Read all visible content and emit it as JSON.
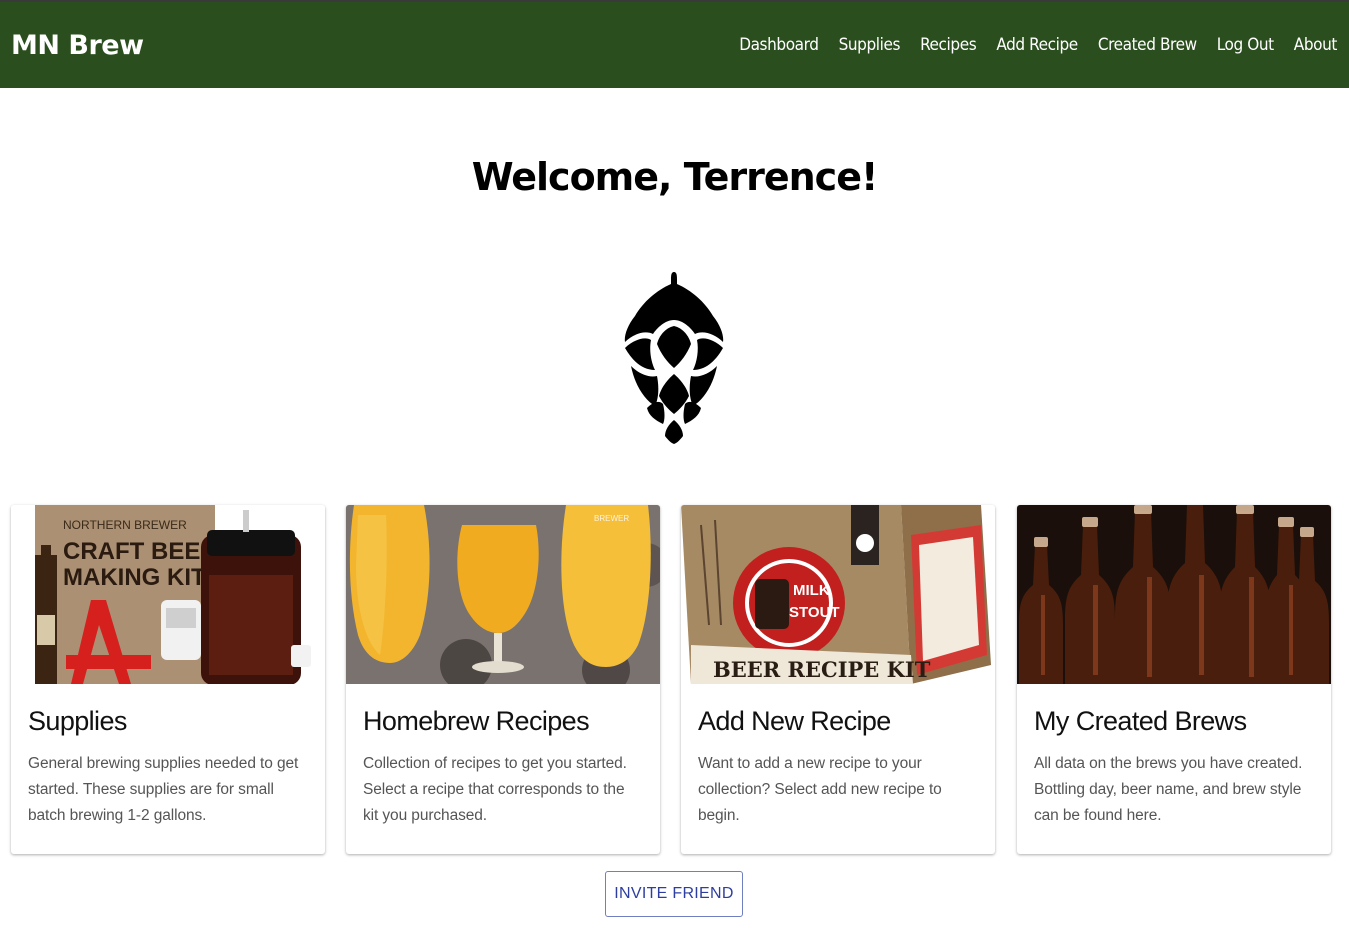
{
  "nav": {
    "brand": "MN Brew",
    "links": [
      "Dashboard",
      "Supplies",
      "Recipes",
      "Add Recipe",
      "Created Brew",
      "Log Out",
      "About"
    ]
  },
  "welcome": "Welcome, Terrence!",
  "logo_icon": "hop-icon",
  "cards": [
    {
      "title": "Supplies",
      "text": "General brewing supplies needed to get started. These supplies are for small batch brewing 1-2 gallons.",
      "image": "craft-beer-making-kit-photo",
      "image_text": [
        "NORTHERN BREWER",
        "CRAFT BEER",
        "MAKING KIT"
      ]
    },
    {
      "title": "Homebrew Recipes",
      "text": "Collection of recipes to get you started. Select a recipe that corresponds to the kit you purchased.",
      "image": "hazy-beer-glasses-photo",
      "image_text": [
        "BREWER"
      ]
    },
    {
      "title": "Add New Recipe",
      "text": "Want to add a new recipe to your collection? Select add new recipe to begin.",
      "image": "beer-recipe-kit-box-photo",
      "image_text": [
        "MILK",
        "STOUT",
        "BEER RECIPE KIT"
      ]
    },
    {
      "title": "My Created Brews",
      "text": "All data on the brews you have created. Bottling day, beer name, and brew style can be found here.",
      "image": "brown-beer-bottles-photo",
      "image_text": []
    }
  ],
  "invite_button": "INVITE FRIEND",
  "colors": {
    "navbar": "#2b4e1f",
    "button_text": "#2e3ea0",
    "button_border": "#6f7fc0"
  }
}
